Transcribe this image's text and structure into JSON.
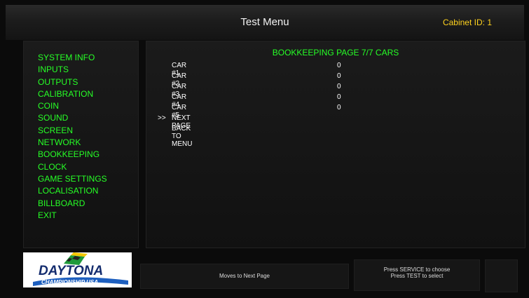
{
  "header": {
    "title": "Test Menu",
    "cabinet_id": "Cabinet ID: 1"
  },
  "sidebar": {
    "items": [
      {
        "label": "SYSTEM INFO"
      },
      {
        "label": "INPUTS"
      },
      {
        "label": "OUTPUTS"
      },
      {
        "label": "CALIBRATION"
      },
      {
        "label": "COIN"
      },
      {
        "label": "SOUND"
      },
      {
        "label": "SCREEN"
      },
      {
        "label": "NETWORK"
      },
      {
        "label": "BOOKKEEPING"
      },
      {
        "label": "CLOCK"
      },
      {
        "label": "GAME SETTINGS"
      },
      {
        "label": "LOCALISATION"
      },
      {
        "label": "BILLBOARD"
      },
      {
        "label": "EXIT"
      }
    ]
  },
  "main": {
    "heading": "BOOKKEEPING PAGE 7/7  CARS",
    "rows": [
      {
        "label": "CAR #1",
        "value": "0"
      },
      {
        "label": "CAR #2",
        "value": "0"
      },
      {
        "label": "CAR #3",
        "value": "0"
      },
      {
        "label": "CAR #4",
        "value": "0"
      },
      {
        "label": "CAR #5",
        "value": "0"
      }
    ],
    "actions": [
      {
        "cursor": ">>",
        "label": "NEXT PAGE"
      },
      {
        "cursor": "",
        "label": "BACK TO MENU"
      }
    ]
  },
  "footer": {
    "hint": "Moves to Next Page",
    "help_line1": "Press SERVICE to choose",
    "help_line2": "Press TEST to select"
  },
  "logo": {
    "word": "DAYTONA",
    "sub": "CHAMPIONSHIP USA"
  }
}
